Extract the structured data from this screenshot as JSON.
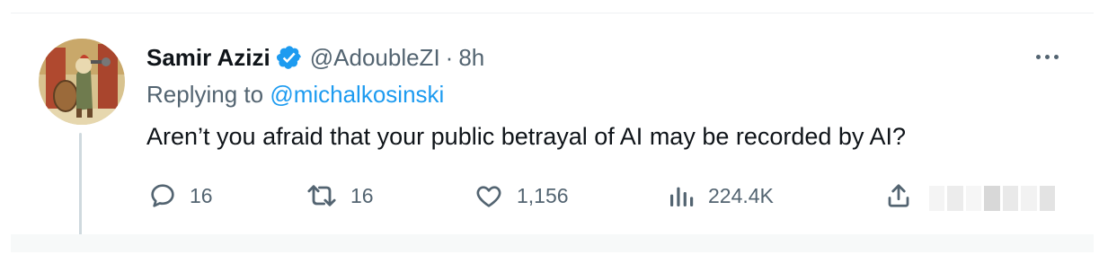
{
  "tweet": {
    "display_name": "Samir Azizi",
    "handle": "@AdoubleZI",
    "separator": "·",
    "time": "8h",
    "replying_prefix": "Replying to",
    "replying_to": "@michalkosinski",
    "text": "Aren’t you afraid that your public betrayal of AI may be recorded by AI?",
    "verified": true
  },
  "actions": {
    "replies": "16",
    "retweets": "16",
    "likes": "1,156",
    "views": "224.4K"
  },
  "icons": {
    "reply": "reply-icon",
    "retweet": "retweet-icon",
    "like": "heart-icon",
    "views": "views-icon",
    "share": "share-icon",
    "more": "more-icon",
    "verified": "verified-badge-icon"
  },
  "colors": {
    "text": "#0f1419",
    "muted": "#536471",
    "accent": "#1d9bf0",
    "thread_line": "#cfd9de"
  }
}
